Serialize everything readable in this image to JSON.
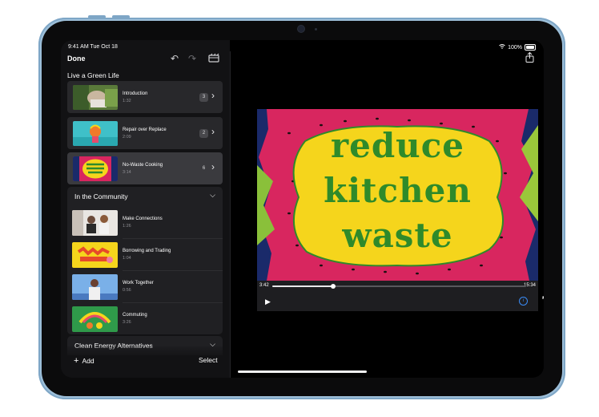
{
  "status": {
    "time": "9:41 AM  Tue Oct 18",
    "battery": "100%"
  },
  "toolbar": {
    "done_label": "Done",
    "undo_icon": "undo-icon",
    "redo_icon": "redo-icon",
    "storyboard_icon": "storyboard-icon",
    "share_icon": "share-icon"
  },
  "project": {
    "title": "Live a Green Life"
  },
  "clips": [
    {
      "title": "Introduction",
      "duration": "1:32",
      "count": "3"
    },
    {
      "title": "Repair over Replace",
      "duration": "2:09",
      "count": "2"
    },
    {
      "title": "No-Waste Cooking",
      "duration": "3:14",
      "count": "6"
    }
  ],
  "group": {
    "title": "In the Community",
    "items": [
      {
        "title": "Make Connections",
        "duration": "1:26"
      },
      {
        "title": "Borrowing and Trading",
        "duration": "1:04"
      },
      {
        "title": "Work Together",
        "duration": "0:56"
      },
      {
        "title": "Commuting",
        "duration": "3:26"
      }
    ]
  },
  "group2": {
    "title": "Clean Energy Alternatives"
  },
  "footer": {
    "add_label": "Add",
    "select_label": "Select"
  },
  "video": {
    "title_lines": [
      "reduce",
      "kitchen",
      "waste"
    ],
    "elapsed": "3:42",
    "total": "15:34",
    "progress": 0.24
  },
  "colors": {
    "accent": "#3a8bf5",
    "panel": "#28282b",
    "video_text": "#2f8a2a",
    "video_blob": "#f5d51c",
    "fruit": "#d8265f"
  }
}
